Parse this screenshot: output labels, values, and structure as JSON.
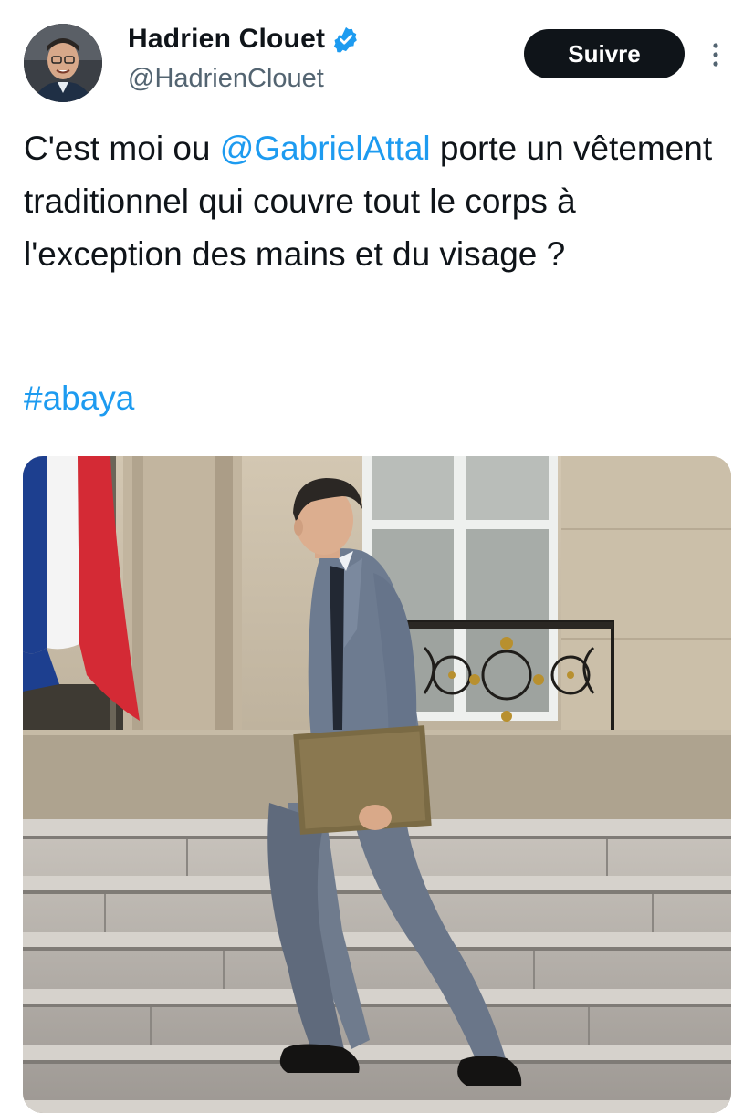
{
  "author": {
    "display_name": "Hadrien Clouet",
    "handle": "@HadrienClouet",
    "verified": true,
    "avatar": "profile-photo"
  },
  "follow_button": {
    "label": "Suivre"
  },
  "more_menu": {
    "icon": "more-vertical-icon"
  },
  "tweet": {
    "text_before_mention": "C'est moi ou ",
    "mention": "@GabrielAttal",
    "text_after_mention": " porte un vêtement traditionnel qui couvre tout le corps à l'exception des mains et du visage ?",
    "hashtag": "#abaya"
  },
  "media": {
    "type": "photo"
  },
  "colors": {
    "link": "#1d9bf0",
    "text": "#0f1419",
    "secondary_text": "#536471",
    "follow_button_bg": "#0f1419",
    "verified_badge": "#1d9bf0"
  }
}
